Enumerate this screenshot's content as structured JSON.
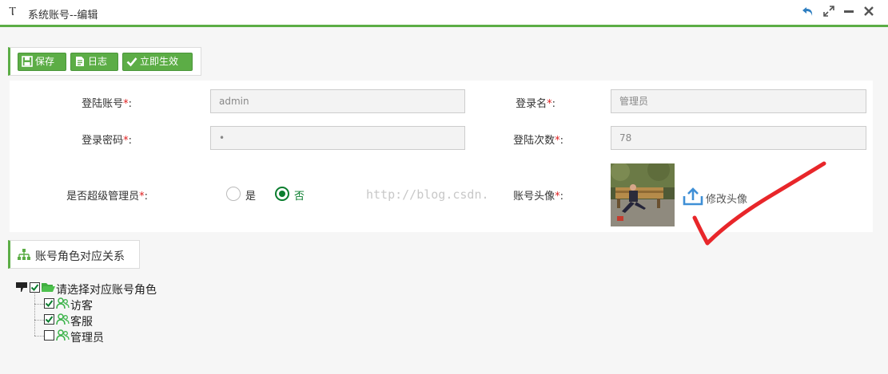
{
  "window": {
    "title": "系统账号--编辑",
    "title_icon": "text-cursor-icon",
    "controls": [
      "back-icon",
      "maximize-icon",
      "minimize-icon",
      "close-icon"
    ]
  },
  "toolbar": {
    "save_label": "保存",
    "log_label": "日志",
    "activate_label": "立即生效"
  },
  "form": {
    "login_account": {
      "label": "登陆账号",
      "required_mark": "*",
      "colon": ":",
      "value": "admin"
    },
    "login_name": {
      "label": "登录名",
      "required_mark": "*",
      "colon": ":",
      "value": "管理员"
    },
    "password": {
      "label": "登录密码",
      "required_mark": "*",
      "colon": ":",
      "value": "•"
    },
    "login_count": {
      "label": "登陆次数",
      "required_mark": "*",
      "colon": ":",
      "value": "78"
    },
    "super_admin": {
      "label": "是否超级管理员",
      "required_mark": "*",
      "colon": ":",
      "options": [
        "是",
        "否"
      ],
      "selected": "否"
    },
    "avatar": {
      "label": "账号头像",
      "required_mark": "*",
      "colon": ":",
      "change_label": "修改头像"
    }
  },
  "watermark": "http://blog.csdn.",
  "relation": {
    "title": "账号角色对应关系",
    "root": {
      "label": "请选择对应账号角色",
      "checked": true
    },
    "roles": [
      {
        "label": "访客",
        "checked": true
      },
      {
        "label": "客服",
        "checked": true
      },
      {
        "label": "管理员",
        "checked": false
      }
    ]
  },
  "colors": {
    "accent": "#5cad46",
    "required": "#e02020",
    "radio": "#0a7d2e",
    "annotation": "#e8262a"
  }
}
